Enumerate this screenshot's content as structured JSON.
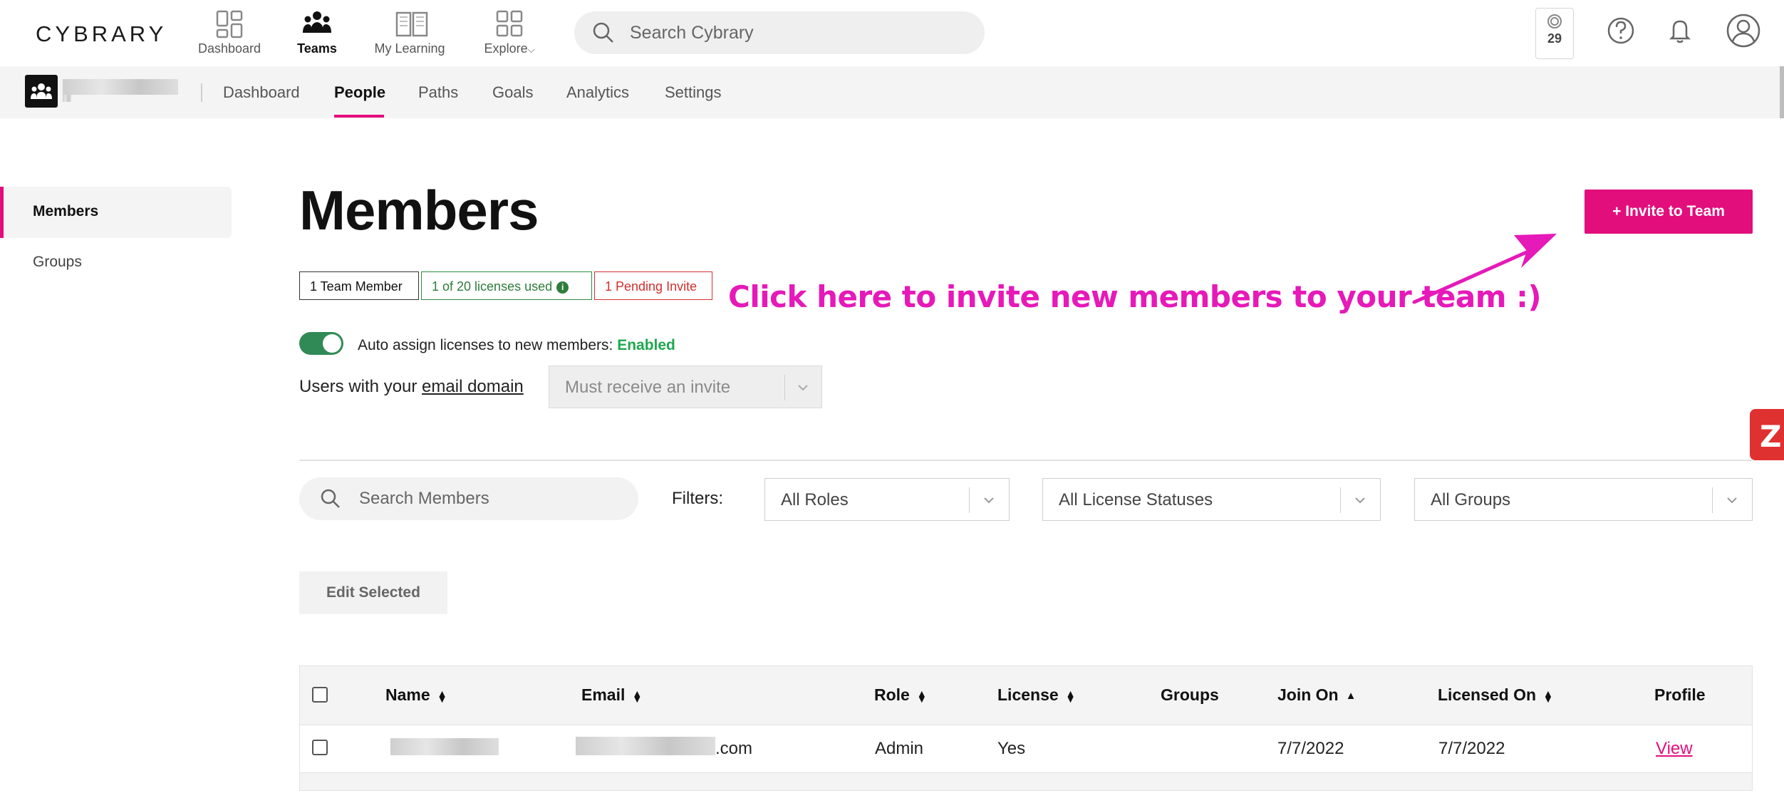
{
  "brand": {
    "logo": "CYBRARY",
    "accent": "#e20e7c",
    "annotation_color": "#e619b9"
  },
  "topnav": {
    "items": [
      {
        "label": "Dashboard",
        "icon": "dashboard-icon"
      },
      {
        "label": "Teams",
        "icon": "teams-icon",
        "active": true
      },
      {
        "label": "My Learning",
        "icon": "book-icon"
      },
      {
        "label": "Explore",
        "icon": "grid-icon",
        "caret": "⌵"
      }
    ],
    "search_placeholder": "Search Cybrary",
    "xp_count": "29"
  },
  "subnav": {
    "tabs": [
      {
        "label": "Dashboard"
      },
      {
        "label": "People",
        "active": true
      },
      {
        "label": "Paths"
      },
      {
        "label": "Goals"
      },
      {
        "label": "Analytics"
      },
      {
        "label": "Settings"
      }
    ]
  },
  "sidebar": {
    "items": [
      {
        "label": "Members",
        "active": true
      },
      {
        "label": "Groups"
      }
    ]
  },
  "main": {
    "title": "Members",
    "invite_button": "+ Invite to Team",
    "pills": {
      "members": "1 Team Member",
      "licenses": "1 of 20 licenses used",
      "pending": "1 Pending Invite"
    },
    "annotation": "Click here to invite new members to your team :)",
    "auto_assign": {
      "label": "Auto assign licenses to new members:",
      "status": "Enabled",
      "on": true
    },
    "domain": {
      "prefix": "Users with your",
      "link": "email domain",
      "select_value": "Must receive an invite"
    },
    "member_search_placeholder": "Search Members",
    "filters": {
      "label": "Filters:",
      "roles": "All Roles",
      "license_statuses": "All License Statuses",
      "groups": "All Groups"
    },
    "edit_selected": "Edit Selected"
  },
  "table": {
    "columns": [
      "Name",
      "Email",
      "Role",
      "License",
      "Groups",
      "Join On",
      "Licensed On",
      "Profile"
    ],
    "rows": [
      {
        "name": "",
        "email_suffix": ".com",
        "role": "Admin",
        "license": "Yes",
        "groups": "",
        "join_on": "7/7/2022",
        "licensed_on": "7/7/2022",
        "profile": "View"
      }
    ]
  }
}
